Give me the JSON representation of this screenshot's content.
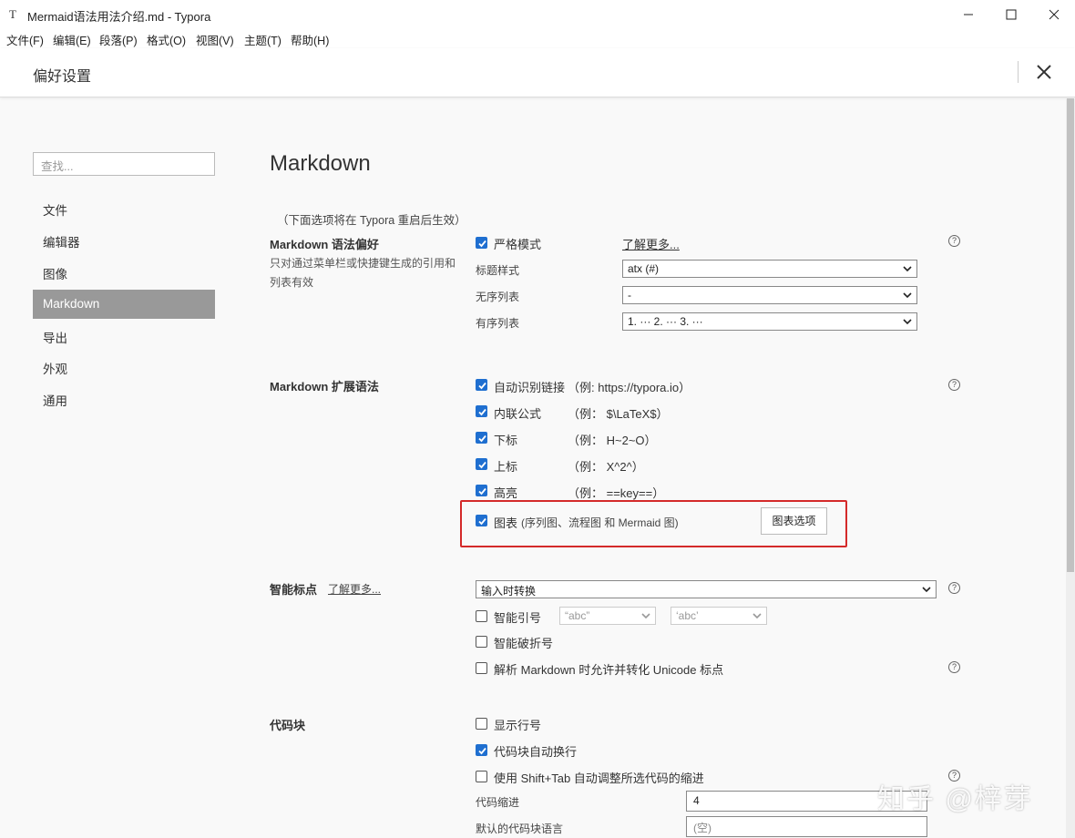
{
  "window": {
    "app_icon": "T",
    "title": "Mermaid语法用法介绍.md - Typora",
    "controls": [
      "minimize-icon",
      "maximize-icon",
      "close-icon"
    ]
  },
  "menu": [
    "文件(F)",
    "编辑(E)",
    "段落(P)",
    "格式(O)",
    "视图(V)",
    "主题(T)",
    "帮助(H)"
  ],
  "header": {
    "title": "偏好设置"
  },
  "sidebar": {
    "search_placeholder": "查找...",
    "items": [
      {
        "label": "文件",
        "active": false
      },
      {
        "label": "编辑器",
        "active": false
      },
      {
        "label": "图像",
        "active": false
      },
      {
        "label": "Markdown",
        "active": true
      },
      {
        "label": "导出",
        "active": false
      },
      {
        "label": "外观",
        "active": false
      },
      {
        "label": "通用",
        "active": false
      }
    ]
  },
  "main": {
    "title": "Markdown",
    "note": "（下面选项将在 Typora 重启后生效）",
    "syntax_pref": {
      "title": "Markdown 语法偏好",
      "desc": "只对通过菜单栏或快捷键生成的引用和列表有效",
      "strict_mode": {
        "label": "严格模式",
        "checked": true
      },
      "learn_more": "了解更多...",
      "heading_style": {
        "label": "标题样式",
        "value": "atx (#)"
      },
      "unordered": {
        "label": "无序列表",
        "value": "-"
      },
      "ordered": {
        "label": "有序列表",
        "value": "1. ··· 2. ··· 3. ···"
      }
    },
    "extended": {
      "title": "Markdown 扩展语法",
      "items": [
        {
          "label": "自动识别链接",
          "example": "（例: https://typora.io）",
          "checked": true
        },
        {
          "label": "内联公式",
          "example": "（例： $\\LaTeX$）",
          "checked": true
        },
        {
          "label": "下标",
          "example": "（例： H~2~O）",
          "checked": true
        },
        {
          "label": "上标",
          "example": "（例： X^2^）",
          "checked": true
        },
        {
          "label": "高亮",
          "example": "（例： ==key==）",
          "checked": true
        }
      ],
      "diagrams": {
        "label": "图表",
        "detail": "(序列图、流程图 和 Mermaid 图)",
        "checked": true,
        "button": "图表选项"
      }
    },
    "smart_punct": {
      "title": "智能标点",
      "learn_more": "了解更多...",
      "mode": "输入时转换",
      "smart_quotes": {
        "label": "智能引号",
        "checked": false,
        "double": "“abc”",
        "single": "‘abc’"
      },
      "smart_dash": {
        "label": "智能破折号",
        "checked": false
      },
      "unicode": {
        "label": "解析 Markdown 时允许并转化 Unicode 标点",
        "checked": false
      }
    },
    "code_block": {
      "title": "代码块",
      "line_numbers": {
        "label": "显示行号",
        "checked": false
      },
      "auto_wrap": {
        "label": "代码块自动换行",
        "checked": true
      },
      "shift_tab": {
        "label": "使用 Shift+Tab 自动调整所选代码的缩进",
        "checked": false
      },
      "indent": {
        "label": "代码缩进",
        "value": "4"
      },
      "default_lang": {
        "label": "默认的代码块语言",
        "placeholder": "(空)"
      }
    }
  },
  "watermark": "知乎 @梓芽"
}
